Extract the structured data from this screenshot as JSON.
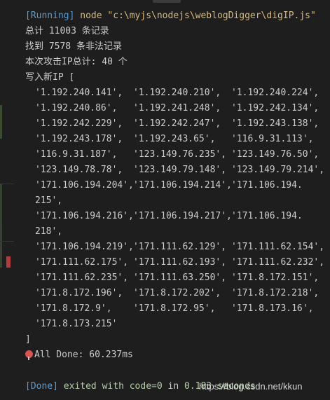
{
  "run": {
    "tag": "[Running]",
    "command": "node \"c:\\myjs\\nodejs\\weblogDigger\\digIP.js\""
  },
  "summary": {
    "total": "总计 11003 条记录",
    "found": "找到 7578 条非法记录",
    "attack_ips": "本次攻击IP总计: 40 个",
    "write_ip": "写入新IP ["
  },
  "ip_rows": [
    [
      "'1.192.240.141',",
      "'1.192.240.210',",
      "'1.192.240.224',"
    ],
    [
      "'1.192.240.86',",
      "'1.192.241.248',",
      "'1.192.242.134',"
    ],
    [
      "'1.192.242.229',",
      "'1.192.242.247',",
      "'1.192.243.138',"
    ],
    [
      "'1.192.243.178',",
      "'1.192.243.65',",
      "'116.9.31.113',"
    ],
    [
      "'116.9.31.187',",
      "'123.149.76.235',",
      "'123.149.76.50',"
    ],
    [
      "'123.149.78.78',",
      "'123.149.79.148',",
      "'123.149.79.214',"
    ],
    [
      "'171.106.194.204',",
      "'171.106.194.214',",
      "'171.106.194."
    ],
    [
      "215',",
      "",
      ""
    ],
    [
      "'171.106.194.216',",
      "'171.106.194.217',",
      "'171.106.194."
    ],
    [
      "218',",
      "",
      ""
    ],
    [
      "'171.106.194.219',",
      "'171.111.62.129',",
      "'171.111.62.154',"
    ],
    [
      "'171.111.62.175',",
      "'171.111.62.193',",
      "'171.111.62.232',"
    ],
    [
      "'171.111.62.235',",
      "'171.111.63.250',",
      "'171.8.172.151',"
    ],
    [
      "'171.8.172.196',",
      "'171.8.172.202',",
      "'171.8.172.218',"
    ],
    [
      "'171.8.172.9',",
      "'171.8.172.95',",
      "'171.8.173.16',"
    ],
    [
      "'171.8.173.215'",
      "",
      ""
    ]
  ],
  "close_bracket": "]",
  "all_done": "All Done: 60.237ms",
  "finish": {
    "tag": "[Done]",
    "text": "exited with",
    "code": "code=0",
    "in": "in",
    "secs": "0.183 seconds"
  },
  "watermark": "https://blog.csdn.net/kkun",
  "icons": {
    "done_marker": "pushpin-icon"
  }
}
